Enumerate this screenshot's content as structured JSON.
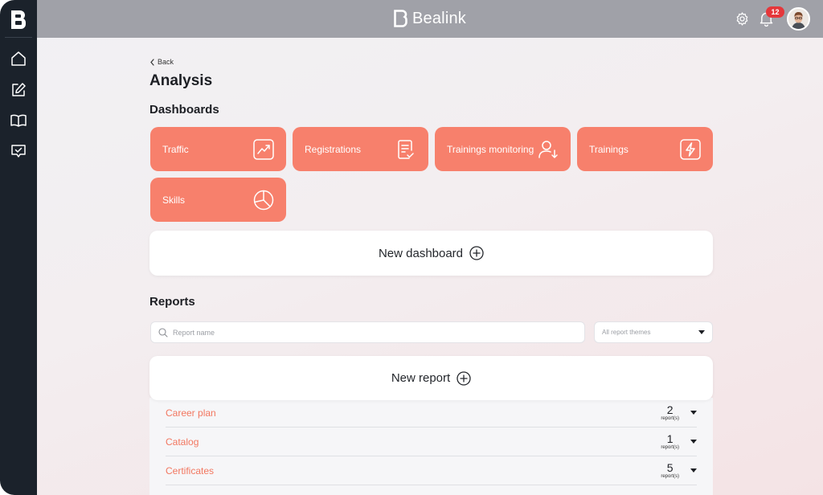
{
  "app": {
    "brand": "Bealink"
  },
  "topbar": {
    "notifications_count": "12"
  },
  "sidebar": {
    "items": [
      {
        "icon": "home-icon"
      },
      {
        "icon": "edit-icon"
      },
      {
        "icon": "book-icon"
      },
      {
        "icon": "check-shield-icon"
      }
    ]
  },
  "page": {
    "back_label": "Back",
    "title": "Analysis"
  },
  "dashboards": {
    "section_title": "Dashboards",
    "tiles": [
      {
        "label": "Traffic",
        "icon": "trend-up-icon"
      },
      {
        "label": "Registrations",
        "icon": "clipboard-check-icon"
      },
      {
        "label": "Trainings monitoring",
        "icon": "user-download-icon"
      },
      {
        "label": "Trainings",
        "icon": "lightning-icon"
      },
      {
        "label": "Skills",
        "icon": "pie-chart-icon"
      }
    ],
    "new_label": "New dashboard"
  },
  "reports": {
    "section_title": "Reports",
    "search_placeholder": "Report name",
    "theme_filter_value": "All report themes",
    "new_label": "New report",
    "categories": [
      {
        "name": "Career plan",
        "count": "2",
        "unit": "report(s)"
      },
      {
        "name": "Catalog",
        "count": "1",
        "unit": "report(s)"
      },
      {
        "name": "Certificates",
        "count": "5",
        "unit": "report(s)"
      }
    ]
  },
  "colors": {
    "accent": "#f7806c",
    "sidebar": "#1b222b",
    "topbar": "#a0a1a8",
    "badge": "#e5373b"
  }
}
